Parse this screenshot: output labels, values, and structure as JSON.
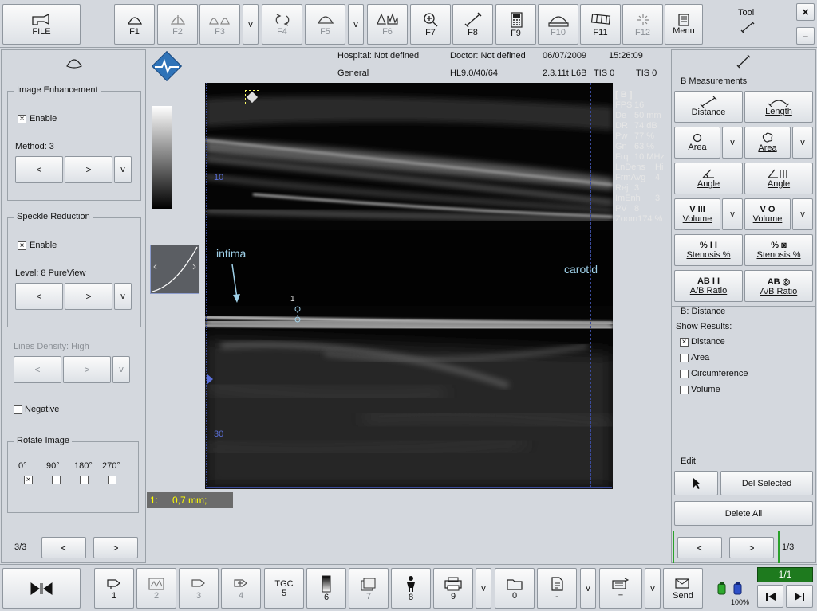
{
  "toolbar_top": {
    "file_label": "FILE",
    "f_buttons": [
      {
        "label": "F1",
        "enabled": true
      },
      {
        "label": "F2",
        "enabled": false
      },
      {
        "label": "F3",
        "enabled": false
      },
      {
        "label": "F4",
        "enabled": false
      },
      {
        "label": "F5",
        "enabled": false
      },
      {
        "label": "F6",
        "enabled": false
      },
      {
        "label": "F7",
        "enabled": true
      },
      {
        "label": "F8",
        "enabled": true
      },
      {
        "label": "F9",
        "enabled": true
      },
      {
        "label": "F10",
        "enabled": false
      },
      {
        "label": "F11",
        "enabled": true
      },
      {
        "label": "F12",
        "enabled": false
      }
    ],
    "menu_label": "Menu",
    "v_label": "v",
    "tool_label": "Tool",
    "close_label": "×",
    "minimize_label": "–"
  },
  "header": {
    "hospital": "Hospital: Not defined",
    "doctor": "Doctor: Not defined",
    "date": "06/07/2009",
    "time": "15:26:09",
    "preset": "General",
    "probe": "HL9.0/40/64",
    "version": "2.3.11t L6B",
    "tis1": "TIS 0",
    "tis2": "TIS 0"
  },
  "left_panel": {
    "image_enhancement": {
      "title": "Image Enhancement",
      "enable_label": "Enable",
      "enabled": true,
      "method_label": "Method: 3"
    },
    "speckle_reduction": {
      "title": "Speckle Reduction",
      "enable_label": "Enable",
      "enabled": true,
      "level_label": "Level: 8 PureView"
    },
    "lines_density_label": "Lines Density: High",
    "negative_label": "Negative",
    "rotate": {
      "title": "Rotate Image",
      "angles": [
        "0°",
        "90°",
        "180°",
        "270°"
      ],
      "selected": "0°"
    },
    "page_label": "3/3",
    "prev": "<",
    "next": ">",
    "v": "v"
  },
  "image": {
    "params_header": "[ B ]",
    "params": [
      {
        "k": "FPS",
        "v": "16"
      },
      {
        "k": "De",
        "v": "50 mm"
      },
      {
        "k": "DR",
        "v": "74 dB"
      },
      {
        "k": "Pw",
        "v": "77 %"
      },
      {
        "k": "Gn",
        "v": "63 %"
      },
      {
        "k": "Frq",
        "v": "10 MHz"
      },
      {
        "k": "LnDens",
        "v": "Hi"
      },
      {
        "k": "FrmAvg",
        "v": "4"
      },
      {
        "k": "Rej",
        "v": "3"
      },
      {
        "k": "ImEnh",
        "v": "3"
      },
      {
        "k": "PV",
        "v": "8"
      },
      {
        "k": "Zoom",
        "v": "174 %"
      }
    ],
    "depth_labels": [
      "10",
      "30"
    ],
    "annotation_intima": "intima",
    "annotation_carotid": "carotid",
    "caliper_number": "1"
  },
  "result_bar": {
    "index": "1:",
    "value": "0,7 mm;"
  },
  "right_panel": {
    "title": "B Measurements",
    "buttons": [
      {
        "label": "Distance"
      },
      {
        "label": "Length"
      },
      {
        "label": "Area"
      },
      {
        "label": "Area"
      },
      {
        "label": "Angle"
      },
      {
        "label": "Angle"
      },
      {
        "label": "Volume"
      },
      {
        "label": "Volume"
      },
      {
        "label": "Stenosis %"
      },
      {
        "label": "Stenosis %"
      },
      {
        "label": "A/B Ratio"
      },
      {
        "label": "A/B Ratio"
      }
    ],
    "icon_texts": {
      "vol1": "V III",
      "vol2": "V O",
      "sten1": "% I I",
      "sten2": "%",
      "ratio1": "AB I I",
      "ratio2": "AB"
    },
    "distance_section": {
      "title": "B: Distance",
      "show_results": "Show Results:",
      "options": [
        {
          "label": "Distance",
          "checked": true
        },
        {
          "label": "Area",
          "checked": false
        },
        {
          "label": "Circumference",
          "checked": false
        },
        {
          "label": "Volume",
          "checked": false
        }
      ]
    },
    "edit": {
      "title": "Edit",
      "del_selected": "Del Selected",
      "delete_all": "Delete All"
    },
    "page_label": "1/3"
  },
  "toolbar_bottom": {
    "buttons": [
      {
        "label": "1"
      },
      {
        "label": "2"
      },
      {
        "label": "3"
      },
      {
        "label": "4"
      },
      {
        "label": "5"
      },
      {
        "label": "6"
      },
      {
        "label": "7"
      },
      {
        "label": "8"
      },
      {
        "label": "9"
      },
      {
        "label": "0"
      },
      {
        "label": "-"
      },
      {
        "label": "="
      }
    ],
    "tgc_label": "TGC",
    "send_label": "Send",
    "battery_label": "100%",
    "page_counter": "1/1"
  },
  "colors": {
    "background": "#d4d8de",
    "image_bg": "#000000",
    "result_text": "#ffff00",
    "annotation": "#9fd0e8",
    "depth_label": "#5a6fd8",
    "page_counter_bg": "#1e7a1e"
  }
}
